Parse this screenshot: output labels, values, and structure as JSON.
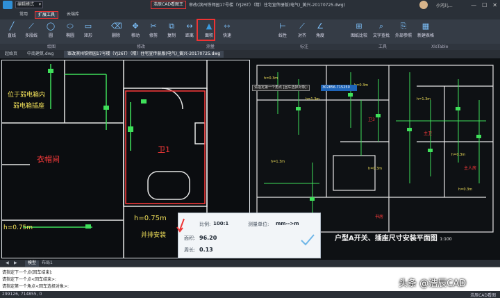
{
  "titlebar": {
    "mode": "编辑模式",
    "window_title": "浩辰CAD看图王",
    "file_title": "审改(滨州铁师园17号楼（YJ26T）（精）住宅宣传册版(电气)_黄兴-20170725.dwg)",
    "user_name": "小河儿..."
  },
  "tabs": {
    "common": "常用",
    "extended": "扩展工具",
    "cloud": "云端库"
  },
  "ribbon": {
    "tools": [
      {
        "label": "直线",
        "icon": "line-icon"
      },
      {
        "label": "多段线",
        "icon": "polyline-icon"
      },
      {
        "label": "圆",
        "icon": "circle-icon"
      },
      {
        "label": "椭圆",
        "icon": "ellipse-icon"
      },
      {
        "label": "矩形",
        "icon": "rectangle-icon"
      },
      {
        "label": "删除",
        "icon": "eraser-icon"
      },
      {
        "label": "移动",
        "icon": "move-icon"
      },
      {
        "label": "修剪",
        "icon": "trim-icon"
      },
      {
        "label": "复制",
        "icon": "copy-icon"
      },
      {
        "label": "距离",
        "icon": "distance-icon"
      },
      {
        "label": "面积",
        "icon": "area-icon"
      },
      {
        "label": "快速",
        "icon": "quick-measure-icon"
      },
      {
        "label": "线性",
        "icon": "linear-dim-icon"
      },
      {
        "label": "对齐",
        "icon": "aligned-dim-icon"
      },
      {
        "label": "角度",
        "icon": "angle-dim-icon"
      },
      {
        "label": "图纸比较",
        "icon": "compare-icon"
      },
      {
        "label": "文字查找",
        "icon": "text-find-icon"
      },
      {
        "label": "外部参照",
        "icon": "xref-icon"
      },
      {
        "label": "新建表格",
        "icon": "table-icon"
      }
    ],
    "groups": {
      "draw": "绘图",
      "modify": "修改",
      "measure": "测量",
      "annotate": "标注",
      "tools": "工具",
      "xmlTable": "XlsTable"
    }
  },
  "doc_tabs": {
    "start": "起始页",
    "tab2": "中南建筑.dwg",
    "active": "审改滨州铁师园17号楼（YJ26T）（精）住宅宣传册版(电气)_黄兴-20170725.dwg"
  },
  "drawing": {
    "label_socket": "位于弱电箱内",
    "label_box": "弱电箱插座",
    "room_cloak": "衣帽间",
    "room_bath": "卫1",
    "h_075": "h=0.75m",
    "h_075b": "h=0.75m",
    "parallel_install": "并排安装",
    "plan_title": "户型A开关、插座尺寸安装平面图",
    "plan_scale": "1:100",
    "input_tip": "请指定第一个角点 [回车选择对象]:",
    "input_coord": "302856.715250"
  },
  "result": {
    "scale_label": "比例:",
    "scale_value": "100:1",
    "unit_label": "测量单位:",
    "unit_value": "mm-->m",
    "area_label": "面积:",
    "area_value": "96.20",
    "perimeter_label": "周长:",
    "perimeter_value": "0.13"
  },
  "layout_tabs": {
    "model": "模型",
    "layout1": "布局1"
  },
  "command": {
    "lines": [
      "请指定下一个点(回车结束):",
      "请指定下一个点<回车结束>:",
      "请指定第一个角点<回车选择对象>:"
    ]
  },
  "status": {
    "coords": "299126, 714855, 0",
    "right": "浩辰CAD看图"
  },
  "watermark": "头条 @浩辰CAD",
  "colors": {
    "highlight": "#e33333",
    "accent": "#1e64b8",
    "cad_green": "#3fe05a",
    "cad_yellow": "#f3e25a"
  }
}
